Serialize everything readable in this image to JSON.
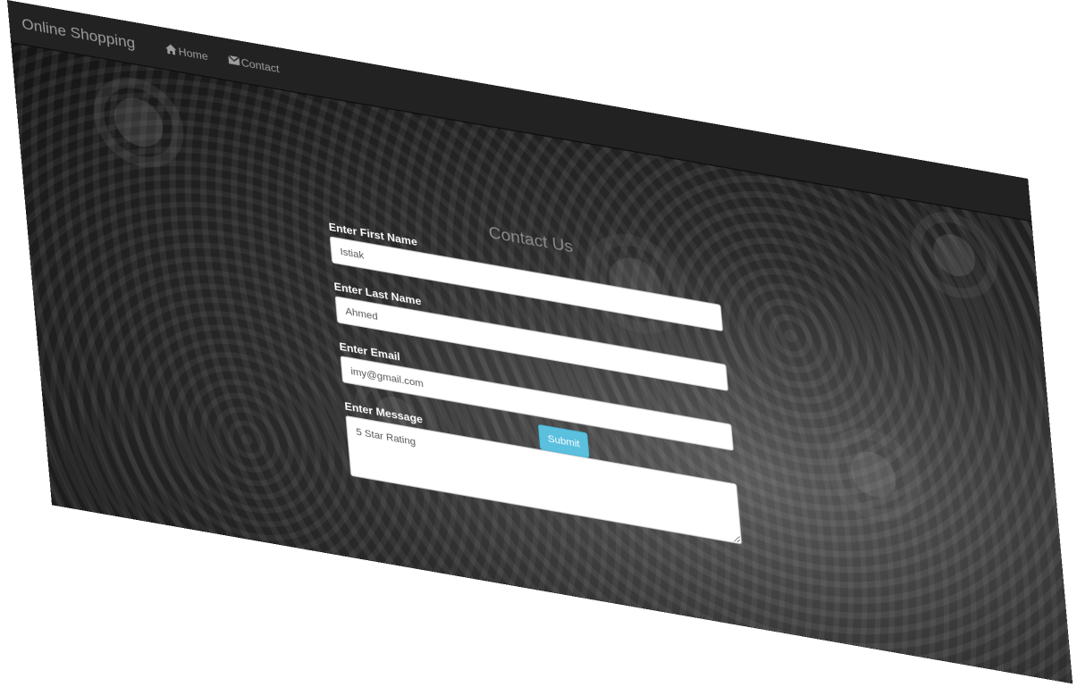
{
  "navbar": {
    "brand": "Online Shopping",
    "links": [
      {
        "label": "Home",
        "icon": "home-icon"
      },
      {
        "label": "Contact",
        "icon": "envelope-icon"
      }
    ]
  },
  "page": {
    "heading": "Contact Us"
  },
  "form": {
    "first_name": {
      "label": "Enter First Name",
      "value": "Istiak"
    },
    "last_name": {
      "label": "Enter Last Name",
      "value": "Ahmed"
    },
    "email": {
      "label": "Enter Email",
      "value": "imy@gmail.com"
    },
    "message": {
      "label": "Enter Message",
      "value": "5 Star Rating"
    },
    "submit_label": "Submit"
  },
  "colors": {
    "navbar_bg": "#222222",
    "nav_text": "#9d9d9d",
    "submit_bg": "#5bc0de",
    "heading_text": "#8a8a8a"
  }
}
